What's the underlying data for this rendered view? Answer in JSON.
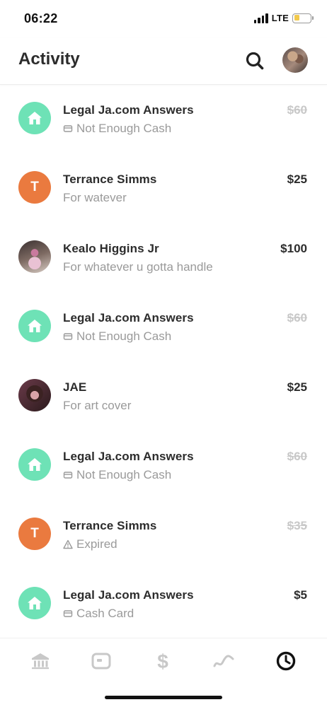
{
  "status_bar": {
    "time": "06:22",
    "network": "LTE"
  },
  "header": {
    "title": "Activity"
  },
  "activities": [
    {
      "name": "Legal Ja.com Answers",
      "subtitle": "Not Enough Cash",
      "amount": "$60",
      "avatar": "home",
      "sub_icon": "card"
    },
    {
      "name": "Terrance Simms",
      "subtitle": "For watever",
      "amount": "$25",
      "avatar": "letter",
      "avatar_letter": "T"
    },
    {
      "name": "Kealo Higgins Jr",
      "subtitle": "For whatever u gotta handle",
      "amount": "$100",
      "avatar": "photo"
    },
    {
      "name": "Legal Ja.com Answers",
      "subtitle": "Not Enough Cash",
      "amount": "$60",
      "avatar": "home",
      "sub_icon": "card"
    },
    {
      "name": "JAE",
      "subtitle": "For art cover",
      "amount": "$25",
      "avatar": "photo"
    },
    {
      "name": "Legal Ja.com Answers",
      "subtitle": "Not Enough Cash",
      "amount": "$60",
      "avatar": "home",
      "sub_icon": "card"
    },
    {
      "name": "Terrance Simms",
      "subtitle": "Expired",
      "amount": "$35",
      "avatar": "letter",
      "avatar_letter": "T",
      "sub_icon": "warning"
    },
    {
      "name": "Legal Ja.com Answers",
      "subtitle": "Cash Card",
      "amount": "$5",
      "avatar": "home",
      "sub_icon": "card"
    }
  ],
  "tabs": [
    "banking-icon",
    "cash-card-icon",
    "dollar-icon",
    "investing-icon",
    "activity-icon"
  ],
  "colors": {
    "accent_green": "#6ee2b6",
    "avatar_orange": "#ea7a3f",
    "struck_amount": "#c8c8c8",
    "subtitle_gray": "#9a9a9a"
  }
}
